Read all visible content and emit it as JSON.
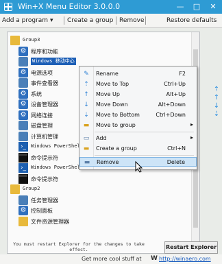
{
  "window": {
    "title": "Win+X Menu Editor 3.0.0.0",
    "minimize": "—",
    "maximize": "□",
    "close": "✕"
  },
  "toolbar": {
    "add_program": "Add a program",
    "add_program_caret": "▾",
    "create_group": "Create a group",
    "remove": "Remove",
    "restore_defaults": "Restore defaults"
  },
  "tree": {
    "items": [
      {
        "label": "Group3",
        "kind": "folder",
        "level": 0
      },
      {
        "label": "程序和功能",
        "kind": "gear",
        "level": 1
      },
      {
        "label": "Windows 移动中心",
        "kind": "other",
        "level": 1,
        "selected": true
      },
      {
        "label": "电源选项",
        "kind": "gear",
        "level": 1
      },
      {
        "label": "事件查看器",
        "kind": "other",
        "level": 1
      },
      {
        "label": "系统",
        "kind": "gear",
        "level": 1
      },
      {
        "label": "设备管理器",
        "kind": "gear",
        "level": 1
      },
      {
        "label": "网络连接",
        "kind": "gear",
        "level": 1
      },
      {
        "label": "磁盘管理",
        "kind": "other",
        "level": 1
      },
      {
        "label": "计算机管理",
        "kind": "other",
        "level": 1
      },
      {
        "label": "Windows PowerShell",
        "kind": "ps",
        "level": 1
      },
      {
        "label": "命令提示符",
        "kind": "cmd",
        "level": 1
      },
      {
        "label": "Windows PowerShell",
        "kind": "ps",
        "level": 1
      },
      {
        "label": "命令提示符",
        "kind": "cmd",
        "level": 1
      },
      {
        "label": "Group2",
        "kind": "folder",
        "level": 0
      },
      {
        "label": "任务管理器",
        "kind": "other",
        "level": 1
      },
      {
        "label": "控制面板",
        "kind": "gear",
        "level": 1
      },
      {
        "label": "文件资源管理器",
        "kind": "folder",
        "level": 1
      }
    ]
  },
  "context_menu": {
    "items": [
      {
        "label": "Rename",
        "shortcut": "F2",
        "icon": "rename-icon"
      },
      {
        "label": "Move to Top",
        "shortcut": "Ctrl+Up",
        "icon": "move-top-icon"
      },
      {
        "label": "Move Up",
        "shortcut": "Alt+Up",
        "icon": "move-up-icon"
      },
      {
        "label": "Move Down",
        "shortcut": "Alt+Down",
        "icon": "move-down-icon"
      },
      {
        "label": "Move to Bottom",
        "shortcut": "Ctrl+Down",
        "icon": "move-bottom-icon"
      },
      {
        "label": "Move to group",
        "shortcut": "",
        "submenu": true,
        "icon": "folder-icon"
      },
      {
        "label": "Add",
        "shortcut": "",
        "submenu": true,
        "icon": "add-icon"
      },
      {
        "label": "Create a group",
        "shortcut": "Ctrl+N",
        "icon": "folder-icon"
      },
      {
        "label": "Remove",
        "shortcut": "Delete",
        "icon": "remove-icon",
        "highlighted": true
      }
    ],
    "submenu_arrow": "▸"
  },
  "side_arrows": [
    "⇡",
    "↑",
    "↓",
    "⇣"
  ],
  "footer": {
    "note": "You must restart Explorer for the changes to take effect.",
    "restart_button": "Restart Explorer",
    "status_prefix": "Get more cool stuff at",
    "status_logo": "W",
    "status_link": "http://winaero.com"
  },
  "colors": {
    "titlebar": "#2e9bd4",
    "menu_highlight": "#cde4f7",
    "selected_row": "#1d5fb6"
  }
}
